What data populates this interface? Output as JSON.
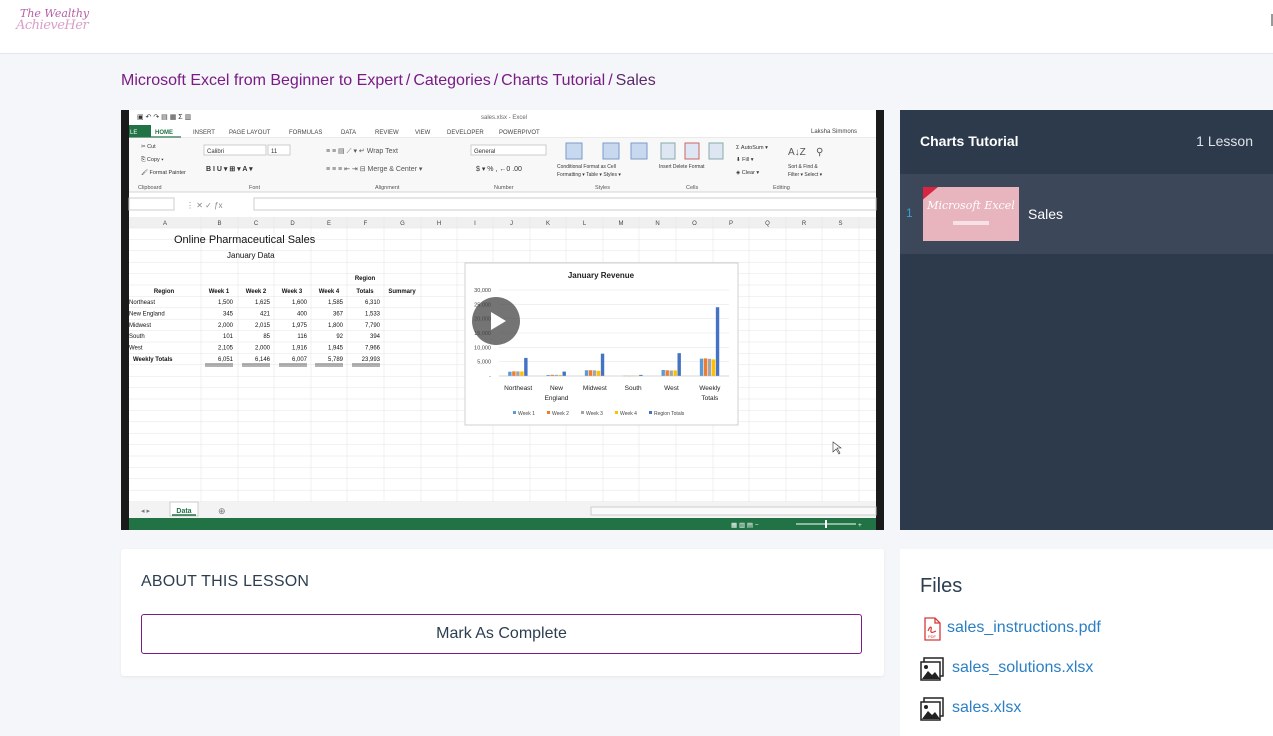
{
  "header": {
    "logo_line1": "The Wealthy",
    "logo_line2": "AchieveHer"
  },
  "breadcrumb": {
    "items": [
      "Microsoft Excel from Beginner to Expert",
      "Categories",
      "Charts Tutorial"
    ],
    "separator": "/",
    "current": "Sales"
  },
  "video": {
    "excel": {
      "title_bar": "sales.xlsx - Excel",
      "user": "Laksha Simmons",
      "tabs": [
        "HOME",
        "INSERT",
        "PAGE LAYOUT",
        "FORMULAS",
        "DATA",
        "REVIEW",
        "VIEW",
        "DEVELOPER",
        "POWERPIVOT"
      ],
      "ribbon_groups": [
        "Clipboard",
        "Font",
        "Alignment",
        "Number",
        "Styles",
        "Cells",
        "Editing"
      ],
      "font_name": "Calibri",
      "font_size": "11",
      "number_format": "General",
      "columns": [
        "A",
        "B",
        "C",
        "D",
        "E",
        "F",
        "G",
        "H",
        "I",
        "J",
        "K",
        "L",
        "M",
        "N",
        "O",
        "P",
        "Q",
        "R",
        "S"
      ],
      "sheet_title": "Online Pharmaceutical Sales",
      "sheet_subtitle": "January Data",
      "table_headers": [
        "Region",
        "Week 1",
        "Week 2",
        "Week 3",
        "Week 4",
        "Region Totals",
        "Summary"
      ],
      "table_rows": [
        [
          "Northeast",
          "1,500",
          "1,625",
          "1,600",
          "1,585",
          "6,310"
        ],
        [
          "New England",
          "345",
          "421",
          "400",
          "367",
          "1,533"
        ],
        [
          "Midwest",
          "2,000",
          "2,015",
          "1,975",
          "1,800",
          "7,790"
        ],
        [
          "South",
          "101",
          "85",
          "116",
          "92",
          "394"
        ],
        [
          "West",
          "2,105",
          "2,000",
          "1,916",
          "1,945",
          "7,966"
        ]
      ],
      "totals_row": [
        "Weekly Totals",
        "6,051",
        "6,146",
        "6,007",
        "5,789",
        "23,993"
      ],
      "sheet_tab": "Data"
    },
    "chart_data": {
      "type": "bar",
      "title": "January Revenue",
      "categories": [
        "Northeast",
        "New England",
        "Midwest",
        "South",
        "West",
        "Weekly Totals"
      ],
      "series": [
        {
          "name": "Week 1",
          "values": [
            1500,
            345,
            2000,
            101,
            2105,
            6051
          ]
        },
        {
          "name": "Week 2",
          "values": [
            1625,
            421,
            2015,
            85,
            2000,
            6146
          ]
        },
        {
          "name": "Week 3",
          "values": [
            1600,
            400,
            1975,
            116,
            1916,
            6007
          ]
        },
        {
          "name": "Week 4",
          "values": [
            1585,
            367,
            1800,
            92,
            1945,
            5789
          ]
        },
        {
          "name": "Region Totals",
          "values": [
            6310,
            1533,
            7790,
            394,
            7966,
            23993
          ]
        }
      ],
      "y_ticks": [
        "30,000",
        "25,000",
        "20,000",
        "15,000",
        "10,000",
        "5,000",
        "-"
      ],
      "ylim": [
        0,
        30000
      ],
      "colors": [
        "#5b9bd5",
        "#ed7d31",
        "#a5a5a5",
        "#ffc000",
        "#4472c4"
      ],
      "legend_position": "bottom"
    }
  },
  "sidebar": {
    "title": "Charts Tutorial",
    "count": "1 Lesson",
    "lessons": [
      {
        "number": "1",
        "label": "Sales",
        "thumb_text": "Microsoft Excel"
      }
    ]
  },
  "about": {
    "heading": "ABOUT THIS LESSON",
    "complete_label": "Mark As Complete"
  },
  "files": {
    "heading": "Files",
    "items": [
      {
        "name": "sales_instructions.pdf",
        "icon": "pdf-icon"
      },
      {
        "name": "sales_solutions.xlsx",
        "icon": "image-file-icon"
      },
      {
        "name": "sales.xlsx",
        "icon": "image-file-icon"
      }
    ]
  },
  "colors": {
    "brand_purple": "#7a1b86",
    "sidebar_bg": "#2c3a4b",
    "link_blue": "#2a7fc4",
    "excel_green": "#217346"
  }
}
